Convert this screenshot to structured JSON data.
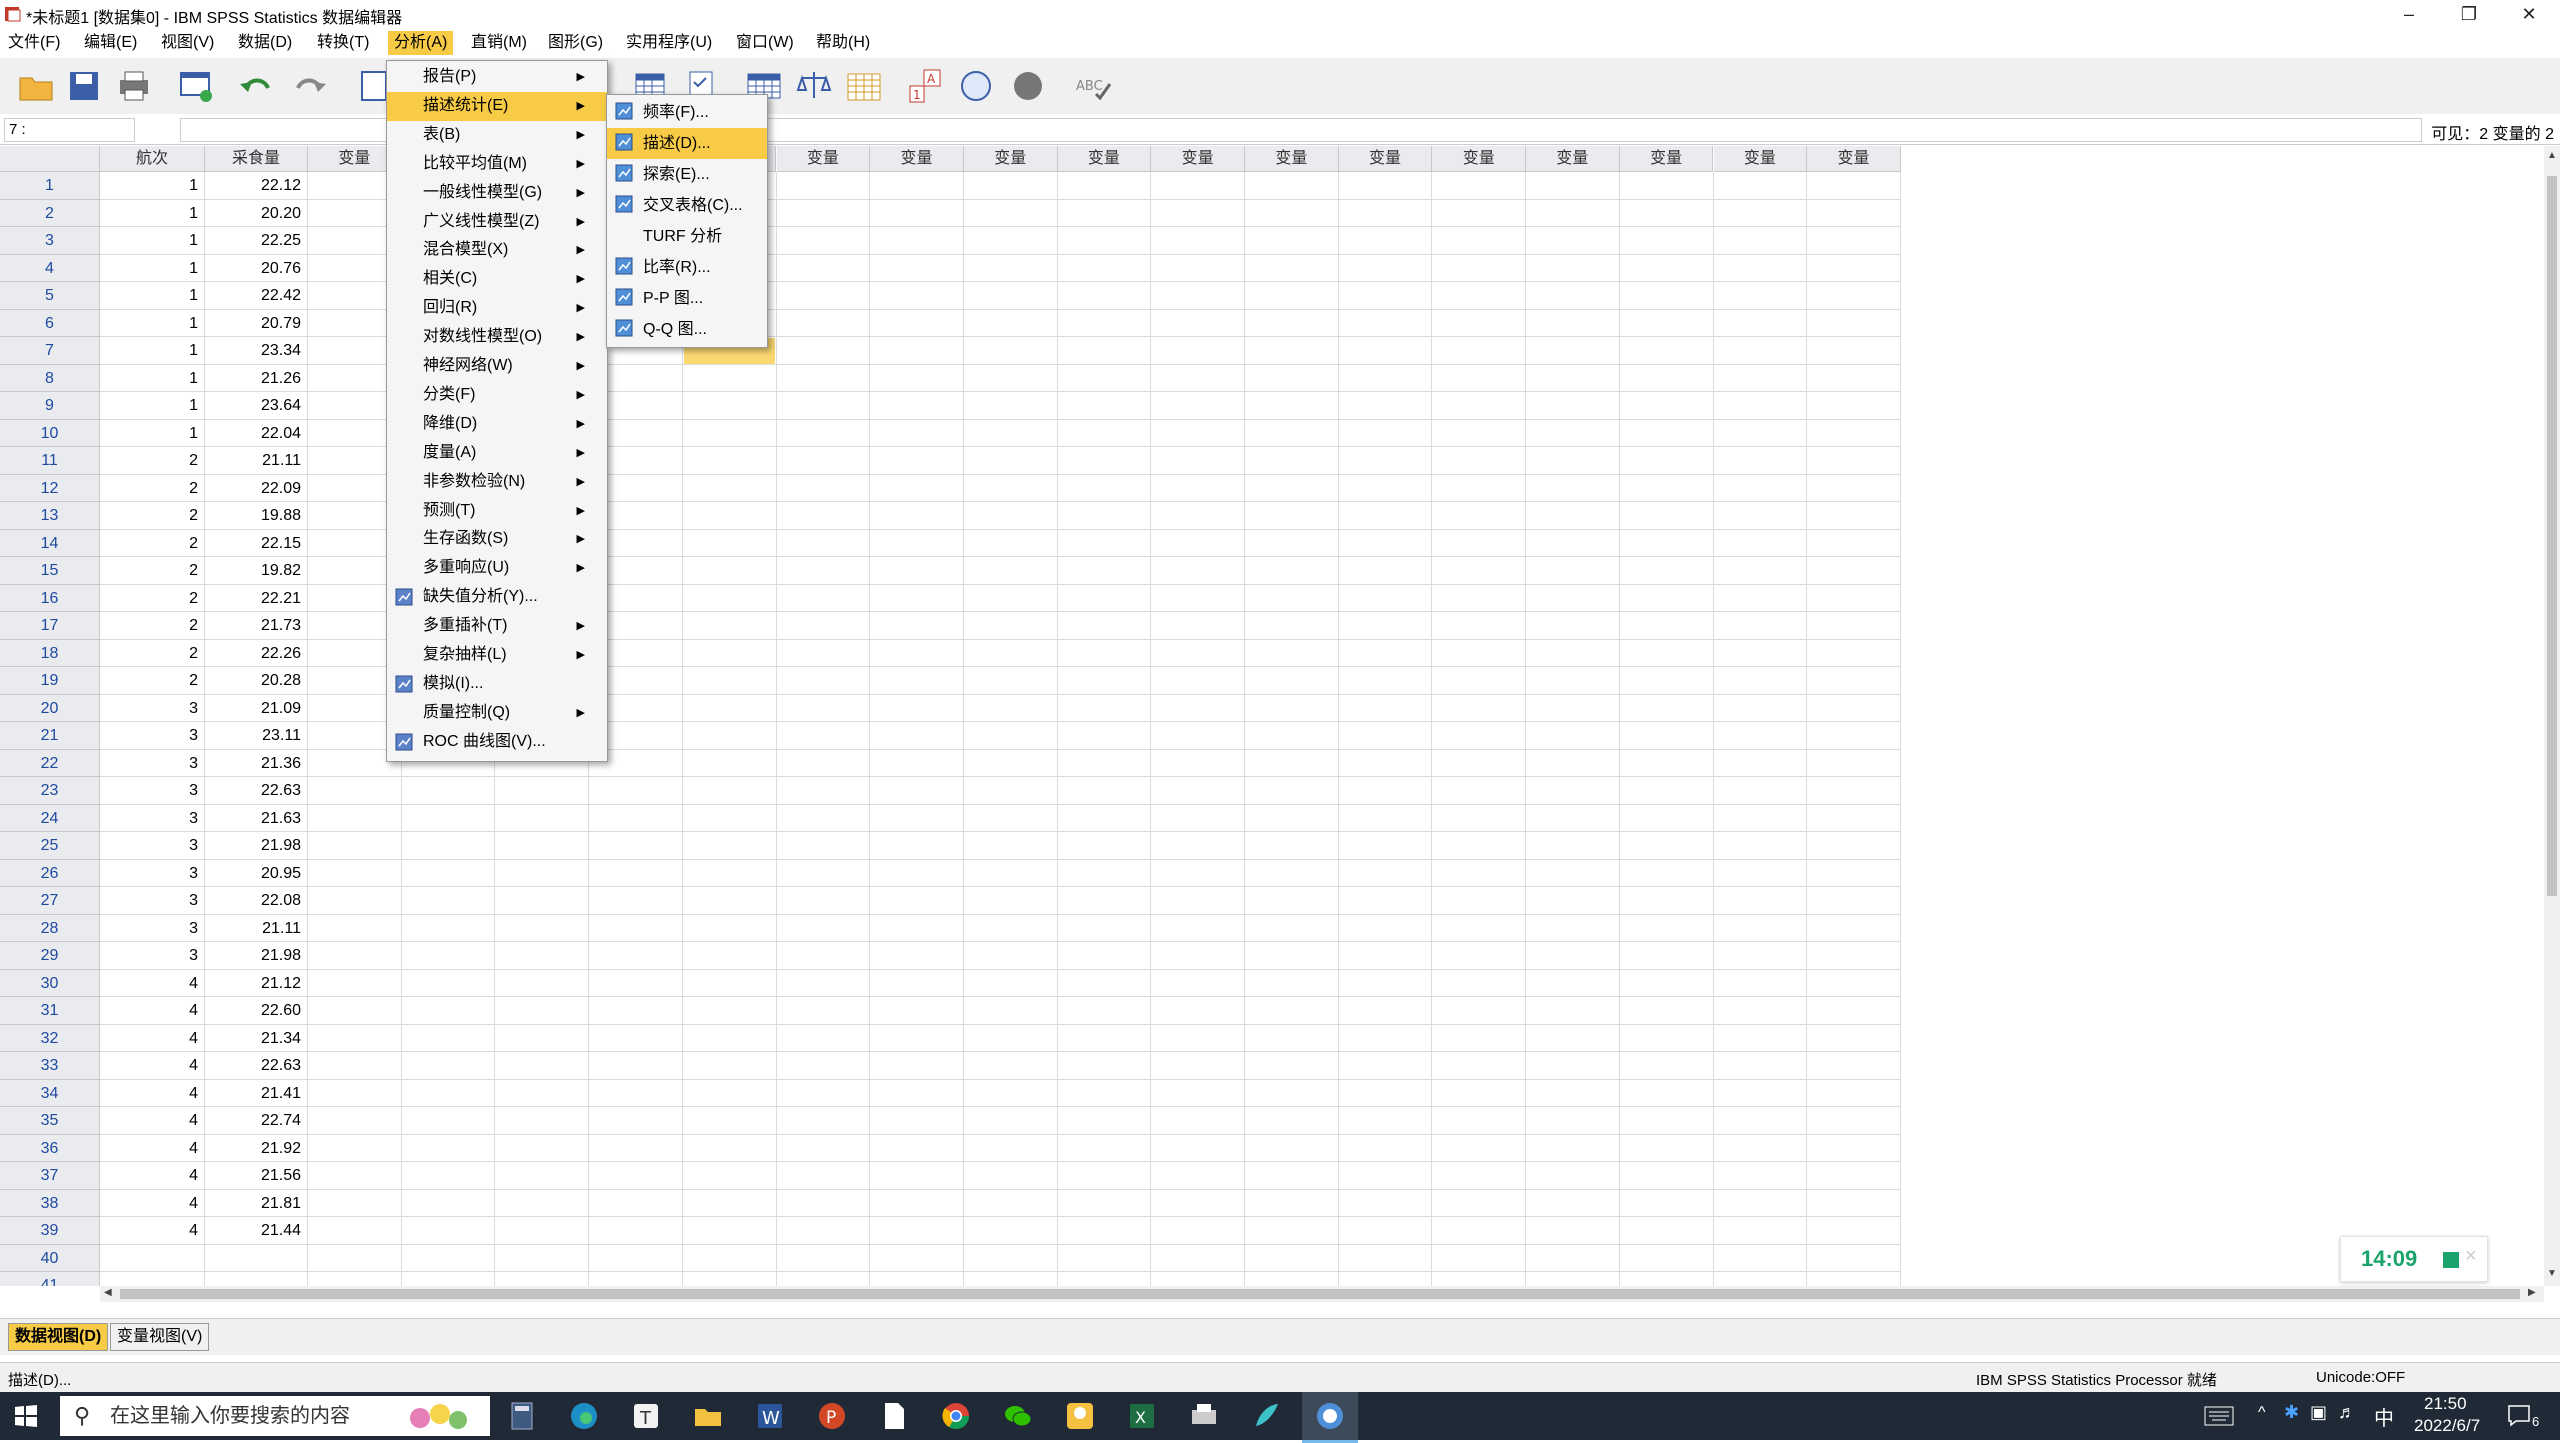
{
  "window": {
    "title": "*未标题1 [数据集0] - IBM SPSS Statistics 数据编辑器"
  },
  "menubar": [
    "文件(F)",
    "编辑(E)",
    "视图(V)",
    "数据(D)",
    "转换(T)",
    "分析(A)",
    "直销(M)",
    "图形(G)",
    "实用程序(U)",
    "窗口(W)",
    "帮助(H)"
  ],
  "cell_ref": "7 :",
  "visible_text": "可见：2 变量的 2",
  "columns": [
    "航次",
    "采食量",
    "变量",
    "变量",
    "变量",
    "变量",
    "变量",
    "变量",
    "变量",
    "变量",
    "变量",
    "变量",
    "变量",
    "变量",
    "变量",
    "变量",
    "变量",
    "变量",
    "变量"
  ],
  "rows": [
    {
      "n": "1",
      "a": "1",
      "b": "22.12"
    },
    {
      "n": "2",
      "a": "1",
      "b": "20.20"
    },
    {
      "n": "3",
      "a": "1",
      "b": "22.25"
    },
    {
      "n": "4",
      "a": "1",
      "b": "20.76"
    },
    {
      "n": "5",
      "a": "1",
      "b": "22.42"
    },
    {
      "n": "6",
      "a": "1",
      "b": "20.79"
    },
    {
      "n": "7",
      "a": "1",
      "b": "23.34"
    },
    {
      "n": "8",
      "a": "1",
      "b": "21.26"
    },
    {
      "n": "9",
      "a": "1",
      "b": "23.64"
    },
    {
      "n": "10",
      "a": "1",
      "b": "22.04"
    },
    {
      "n": "11",
      "a": "2",
      "b": "21.11"
    },
    {
      "n": "12",
      "a": "2",
      "b": "22.09"
    },
    {
      "n": "13",
      "a": "2",
      "b": "19.88"
    },
    {
      "n": "14",
      "a": "2",
      "b": "22.15"
    },
    {
      "n": "15",
      "a": "2",
      "b": "19.82"
    },
    {
      "n": "16",
      "a": "2",
      "b": "22.21"
    },
    {
      "n": "17",
      "a": "2",
      "b": "21.73"
    },
    {
      "n": "18",
      "a": "2",
      "b": "22.26"
    },
    {
      "n": "19",
      "a": "2",
      "b": "20.28"
    },
    {
      "n": "20",
      "a": "3",
      "b": "21.09"
    },
    {
      "n": "21",
      "a": "3",
      "b": "23.11"
    },
    {
      "n": "22",
      "a": "3",
      "b": "21.36"
    },
    {
      "n": "23",
      "a": "3",
      "b": "22.63"
    },
    {
      "n": "24",
      "a": "3",
      "b": "21.63"
    },
    {
      "n": "25",
      "a": "3",
      "b": "21.98"
    },
    {
      "n": "26",
      "a": "3",
      "b": "20.95"
    },
    {
      "n": "27",
      "a": "3",
      "b": "22.08"
    },
    {
      "n": "28",
      "a": "3",
      "b": "21.11"
    },
    {
      "n": "29",
      "a": "3",
      "b": "21.98"
    },
    {
      "n": "30",
      "a": "4",
      "b": "21.12"
    },
    {
      "n": "31",
      "a": "4",
      "b": "22.60"
    },
    {
      "n": "32",
      "a": "4",
      "b": "21.34"
    },
    {
      "n": "33",
      "a": "4",
      "b": "22.63"
    },
    {
      "n": "34",
      "a": "4",
      "b": "21.41"
    },
    {
      "n": "35",
      "a": "4",
      "b": "22.74"
    },
    {
      "n": "36",
      "a": "4",
      "b": "21.92"
    },
    {
      "n": "37",
      "a": "4",
      "b": "21.56"
    },
    {
      "n": "38",
      "a": "4",
      "b": "21.81"
    },
    {
      "n": "39",
      "a": "4",
      "b": "21.44"
    },
    {
      "n": "40",
      "a": "",
      "b": ""
    },
    {
      "n": "41",
      "a": "",
      "b": ""
    }
  ],
  "analysis_menu": [
    {
      "label": "报告(P)",
      "arrow": true
    },
    {
      "label": "描述统计(E)",
      "arrow": true,
      "highlight": true
    },
    {
      "label": "表(B)",
      "arrow": true
    },
    {
      "label": "比较平均值(M)",
      "arrow": true
    },
    {
      "label": "一般线性模型(G)",
      "arrow": true
    },
    {
      "label": "广义线性模型(Z)",
      "arrow": true
    },
    {
      "label": "混合模型(X)",
      "arrow": true
    },
    {
      "label": "相关(C)",
      "arrow": true
    },
    {
      "label": "回归(R)",
      "arrow": true
    },
    {
      "label": "对数线性模型(O)",
      "arrow": true
    },
    {
      "label": "神经网络(W)",
      "arrow": true
    },
    {
      "label": "分类(F)",
      "arrow": true
    },
    {
      "label": "降维(D)",
      "arrow": true
    },
    {
      "label": "度量(A)",
      "arrow": true
    },
    {
      "label": "非参数检验(N)",
      "arrow": true
    },
    {
      "label": "预测(T)",
      "arrow": true
    },
    {
      "label": "生存函数(S)",
      "arrow": true
    },
    {
      "label": "多重响应(U)",
      "arrow": true
    },
    {
      "label": "缺失值分析(Y)...",
      "arrow": false,
      "icon": true
    },
    {
      "label": "多重插补(T)",
      "arrow": true
    },
    {
      "label": "复杂抽样(L)",
      "arrow": true
    },
    {
      "label": "模拟(I)...",
      "arrow": false,
      "icon": true
    },
    {
      "label": "质量控制(Q)",
      "arrow": true
    },
    {
      "label": "ROC 曲线图(V)...",
      "arrow": false,
      "icon": true
    }
  ],
  "descriptive_submenu": [
    {
      "label": "频率(F)...",
      "icon": true
    },
    {
      "label": "描述(D)...",
      "icon": true,
      "highlight": true
    },
    {
      "label": "探索(E)...",
      "icon": true
    },
    {
      "label": "交叉表格(C)...",
      "icon": true
    },
    {
      "label": "TURF 分析",
      "icon": false
    },
    {
      "label": "比率(R)...",
      "icon": true
    },
    {
      "label": "P-P 图...",
      "icon": true
    },
    {
      "label": "Q-Q 图...",
      "icon": true
    }
  ],
  "tabs": {
    "data_view": "数据视图(D)",
    "variable_view": "变量视图(V)"
  },
  "status": {
    "left": "描述(D)...",
    "processor": "IBM SPSS Statistics Processor 就绪",
    "unicode": "Unicode:OFF"
  },
  "timer": {
    "time": "14:09"
  },
  "taskbar": {
    "search_placeholder": "在这里输入你要搜索的内容",
    "time": "21:50",
    "date": "2022/6/7",
    "ime": "中",
    "notif": "6"
  },
  "colors": {
    "highlight": "#f7cb45",
    "selected_cell": "#fbd870",
    "row_header_text": "#1f4aa0",
    "timer_green": "#1aa36b"
  }
}
